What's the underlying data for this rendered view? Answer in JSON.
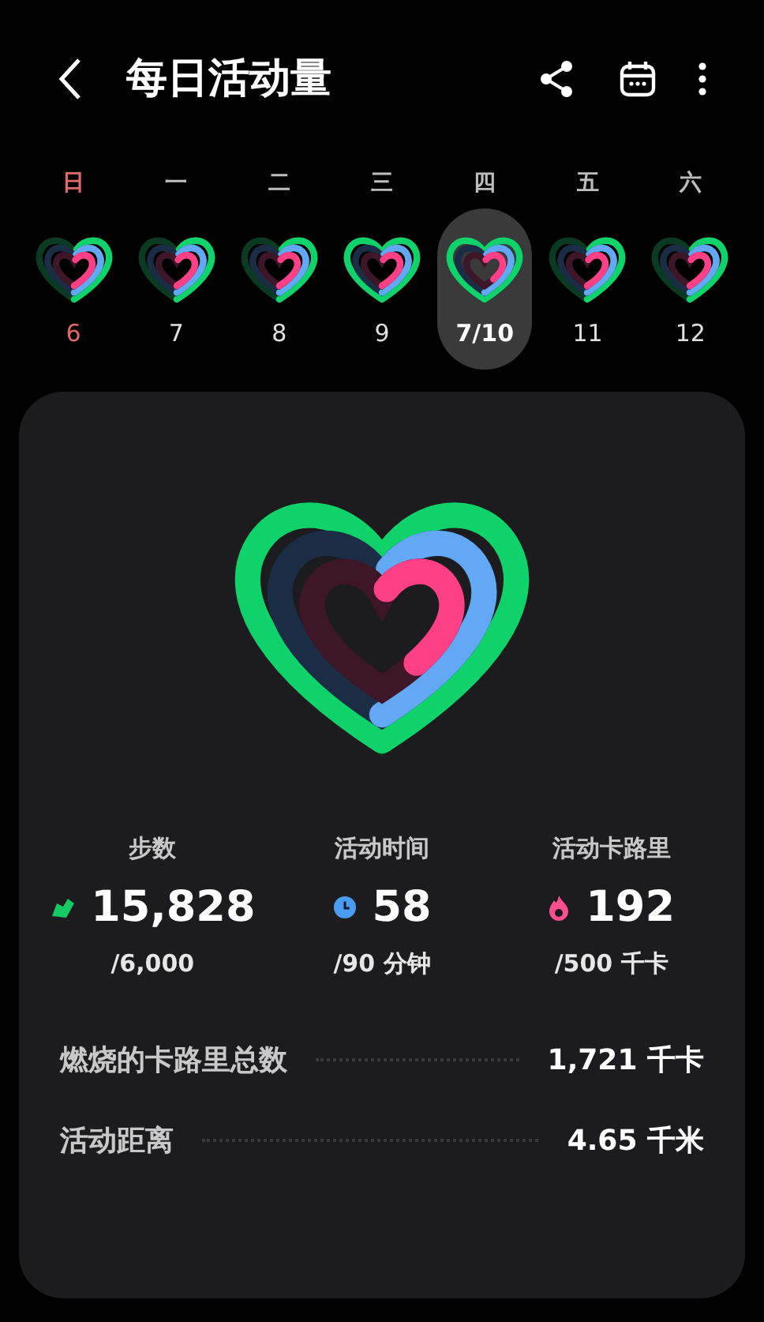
{
  "header": {
    "title": "每日活动量"
  },
  "days": [
    {
      "weekday": "日",
      "date": "6",
      "selected": false,
      "sunday": true
    },
    {
      "weekday": "一",
      "date": "7",
      "selected": false,
      "sunday": false
    },
    {
      "weekday": "二",
      "date": "8",
      "selected": false,
      "sunday": false
    },
    {
      "weekday": "三",
      "date": "9",
      "selected": false,
      "sunday": false
    },
    {
      "weekday": "四",
      "date": "7/10",
      "selected": true,
      "sunday": false
    },
    {
      "weekday": "五",
      "date": "11",
      "selected": false,
      "sunday": false
    },
    {
      "weekday": "六",
      "date": "12",
      "selected": false,
      "sunday": false
    }
  ],
  "stats": [
    {
      "kind": "steps",
      "label": "步数",
      "value": "15,828",
      "target": "/6,000"
    },
    {
      "kind": "time",
      "label": "活动时间",
      "value": "58",
      "target": "/90 分钟"
    },
    {
      "kind": "calories",
      "label": "活动卡路里",
      "value": "192",
      "target": "/500 千卡"
    }
  ],
  "rows": [
    {
      "label": "燃烧的卡路里总数",
      "value": "1,721 千卡"
    },
    {
      "label": "活动距离",
      "value": "4.65 千米"
    }
  ]
}
